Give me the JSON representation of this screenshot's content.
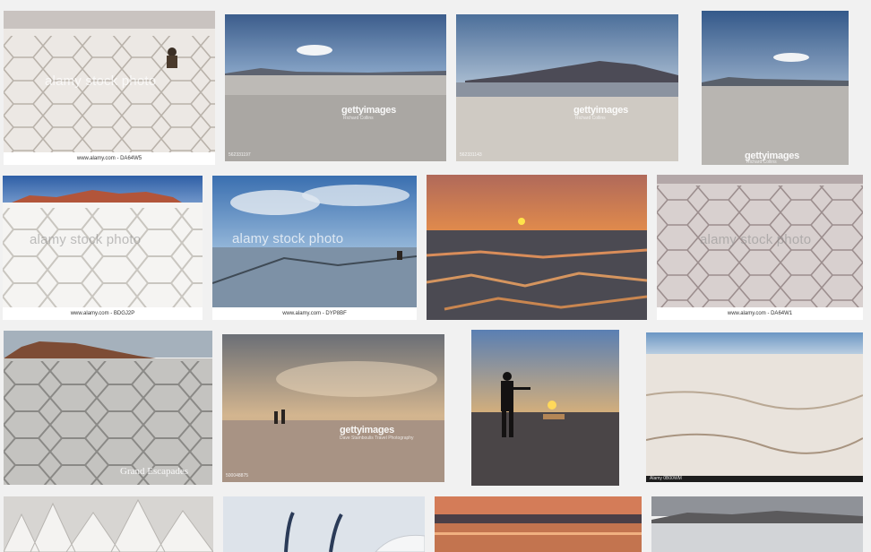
{
  "colors": {
    "page_background": "#f1f1f1",
    "caption_background": "#ffffff",
    "caption_text": "#333333"
  },
  "watermarks": {
    "alamy": "alamy stock photo",
    "getty": "gettyimages"
  },
  "tiles": [
    {
      "caption": "www.alamy.com - DA64W5"
    },
    {
      "credit": "Richard Collins",
      "stock_id": "562331197"
    },
    {
      "credit": "Richard Collins",
      "stock_id": "562331143"
    },
    {
      "credit": "Richard Collins"
    },
    {
      "caption": "www.alamy.com - BDGJ2P"
    },
    {
      "caption": "www.alamy.com - DYP8BF"
    },
    {},
    {
      "caption": "www.alamy.com - DA64W1"
    },
    {
      "watermark": "Grand Escapades"
    },
    {
      "credit": "Dave Stamboulis Travel Photography",
      "stock_id": "500048875"
    },
    {},
    {
      "stock_id": "Alamy 0B00WM"
    },
    {},
    {},
    {},
    {}
  ]
}
